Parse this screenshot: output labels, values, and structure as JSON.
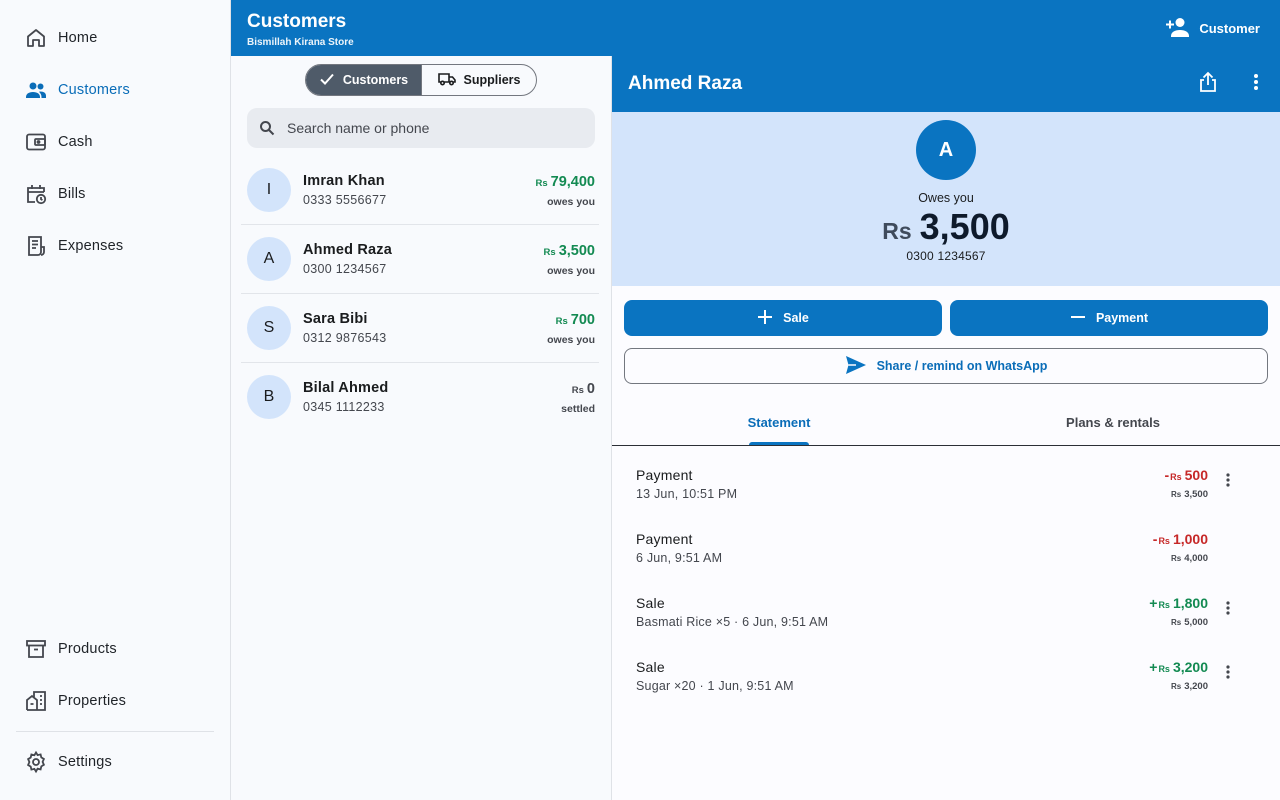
{
  "sidebar": {
    "items": [
      {
        "label": "Home",
        "icon": "home-icon"
      },
      {
        "label": "Customers",
        "icon": "people-icon",
        "active": true
      },
      {
        "label": "Cash",
        "icon": "wallet-icon"
      },
      {
        "label": "Bills",
        "icon": "calendar-clock-icon"
      },
      {
        "label": "Expenses",
        "icon": "receipt-icon"
      },
      {
        "label": "Products",
        "icon": "archive-box-icon"
      },
      {
        "label": "Properties",
        "icon": "building-icon"
      },
      {
        "label": "Settings",
        "icon": "gear-icon"
      }
    ]
  },
  "topbar": {
    "title": "Customers",
    "subtitle": "Bismillah Kirana Store",
    "add_label": "Customer"
  },
  "list": {
    "segments": {
      "customers": "Customers",
      "suppliers": "Suppliers"
    },
    "search_placeholder": "Search name or phone",
    "currency": "Rs",
    "rows": [
      {
        "initial": "I",
        "name": "Imran Khan",
        "phone": "0333 5556677",
        "amount": "79,400",
        "status": "owes you"
      },
      {
        "initial": "A",
        "name": "Ahmed Raza",
        "phone": "0300 1234567",
        "amount": "3,500",
        "status": "owes you"
      },
      {
        "initial": "S",
        "name": "Sara Bibi",
        "phone": "0312 9876543",
        "amount": "700",
        "status": "owes you"
      },
      {
        "initial": "B",
        "name": "Bilal Ahmed",
        "phone": "0345 1112233",
        "amount": "0",
        "status": "settled"
      }
    ]
  },
  "detail": {
    "name": "Ahmed Raza",
    "initial": "A",
    "owes_label": "Owes you",
    "currency": "Rs",
    "balance": "3,500",
    "phone": "0300 1234567",
    "sale_label": "Sale",
    "payment_label": "Payment",
    "whatsapp_label": "Share / remind on WhatsApp",
    "tabs": {
      "statement": "Statement",
      "plans": "Plans & rentals"
    },
    "entries": [
      {
        "title": "Payment",
        "detail": "13 Jun, 10:51 PM",
        "sign": "-",
        "amount": "500",
        "running": "3,500"
      },
      {
        "title": "Payment",
        "detail": "6 Jun, 9:51 AM",
        "sign": "-",
        "amount": "1,000",
        "running": "4,000"
      },
      {
        "title": "Sale",
        "detail": "Basmati Rice ×5 · 6 Jun, 9:51 AM",
        "sign": "+",
        "amount": "1,800",
        "running": "5,000"
      },
      {
        "title": "Sale",
        "detail": "Sugar ×20 · 1 Jun, 9:51 AM",
        "sign": "+",
        "amount": "3,200",
        "running": "3,200"
      }
    ]
  },
  "colors": {
    "primary": "#0a74c1",
    "hero": "#d3e4fb",
    "positive": "#138a52",
    "negative": "#c62828"
  }
}
